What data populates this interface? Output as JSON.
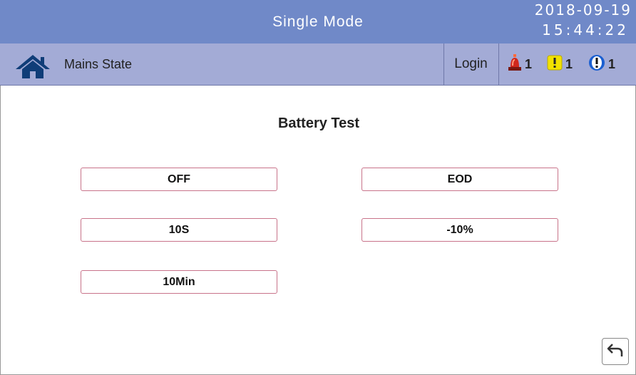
{
  "header": {
    "mode": "Single Mode",
    "date": "2018-09-19",
    "time": "15:44:22"
  },
  "status": {
    "state": "Mains State",
    "login": "Login",
    "alarms": [
      {
        "icon": "siren-icon",
        "count": "1",
        "color": "#d0281c"
      },
      {
        "icon": "warning-icon",
        "count": "1",
        "color": "#f2e200"
      },
      {
        "icon": "info-icon",
        "count": "1",
        "color": "#1a5fd1"
      }
    ]
  },
  "page": {
    "title": "Battery Test",
    "options": {
      "off": "OFF",
      "eod": "EOD",
      "s10": "10S",
      "minus10": "-10%",
      "min10": "10Min"
    }
  },
  "colors": {
    "titlebar": "#7089c8",
    "statusbar": "#a3abd6",
    "option_border": "#c8738a"
  }
}
